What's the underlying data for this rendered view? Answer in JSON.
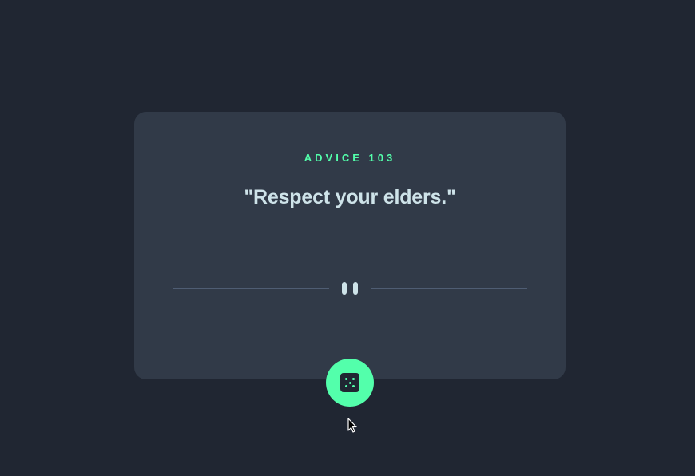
{
  "advice": {
    "label": "ADVICE 103",
    "quote": "\"Respect your elders.\""
  },
  "divider": {
    "icon": "pause-icon"
  },
  "dice_button": {
    "icon": "dice-icon"
  },
  "colors": {
    "background": "#202632",
    "card": "#313a48",
    "accent": "#53ffab",
    "text": "#cee3e9",
    "divider": "#4f5d73"
  }
}
